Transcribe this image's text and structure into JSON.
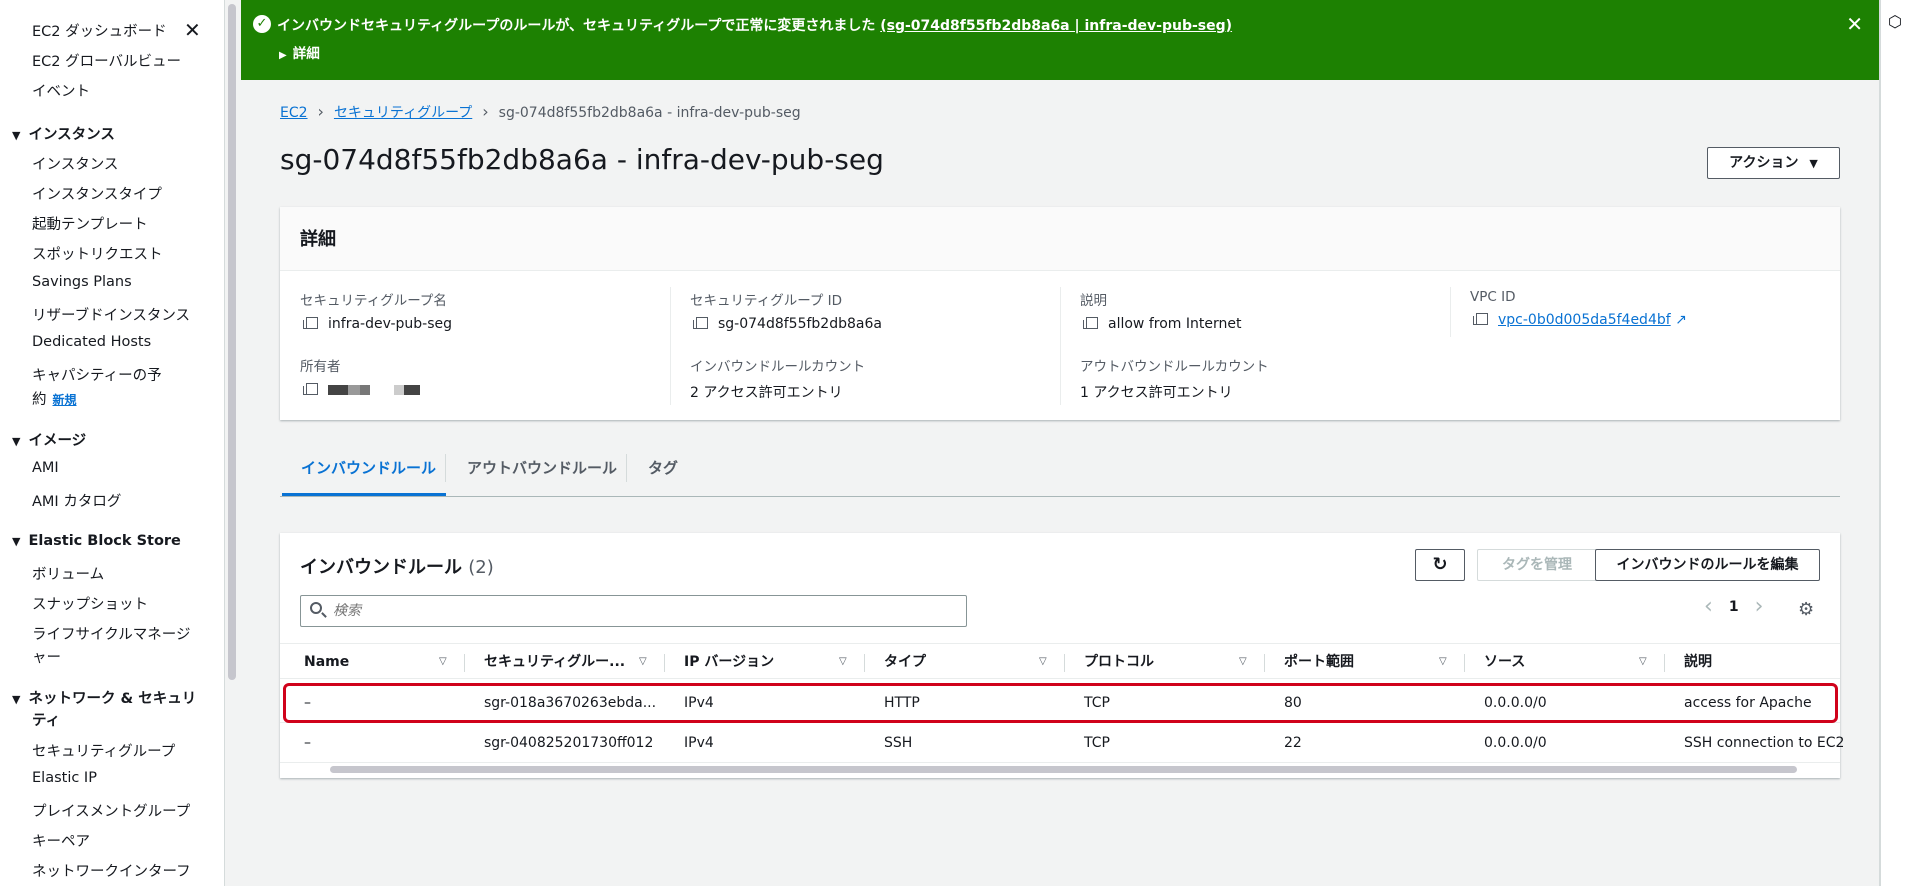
{
  "sidebar": {
    "top_items": [
      "EC2 ダッシュボード",
      "EC2 グローバルビュー",
      "イベント"
    ],
    "sections": [
      {
        "title": "インスタンス",
        "items": [
          "インスタンス",
          "インスタンスタイプ",
          "起動テンプレート",
          "スポットリクエスト",
          "Savings Plans",
          "リザーブドインスタンス",
          "Dedicated Hosts",
          "キャパシティーの予",
          "約"
        ]
      },
      {
        "title": "イメージ",
        "items": [
          "AMI",
          "AMI カタログ"
        ]
      },
      {
        "title": "Elastic Block Store",
        "items": [
          "ボリューム",
          "スナップショット",
          "ライフサイクルマネージ",
          "ャー"
        ]
      },
      {
        "title": "ネットワーク & セキュリ",
        "title2": "ティ",
        "items": [
          "セキュリティグループ",
          "Elastic IP",
          "プレイスメントグループ",
          "キーペア",
          "ネットワークインターフ"
        ]
      }
    ],
    "new_badge": "新規"
  },
  "flash": {
    "message": "インバウンドセキュリティグループのルールが、セキュリティグループで正常に変更されました",
    "link": "(sg-074d8f55fb2db8a6a | infra-dev-pub-seg)",
    "details": "詳細"
  },
  "breadcrumb": {
    "ec2": "EC2",
    "sg": "セキュリティグループ",
    "current": "sg-074d8f55fb2db8a6a - infra-dev-pub-seg"
  },
  "page_title": "sg-074d8f55fb2db8a6a - infra-dev-pub-seg",
  "action_label": "アクション",
  "details": {
    "heading": "詳細",
    "sg_name_label": "セキュリティグループ名",
    "sg_name": "infra-dev-pub-seg",
    "sg_id_label": "セキュリティグループ ID",
    "sg_id": "sg-074d8f55fb2db8a6a",
    "desc_label": "説明",
    "desc": "allow from Internet",
    "vpc_label": "VPC ID",
    "vpc": "vpc-0b0d005da5f4ed4bf",
    "owner_label": "所有者",
    "inbound_count_label": "インバウンドルールカウント",
    "inbound_count": "2 アクセス許可エントリ",
    "outbound_count_label": "アウトバウンドルールカウント",
    "outbound_count": "1 アクセス許可エントリ"
  },
  "tabs": [
    "インバウンドルール",
    "アウトバウンドルール",
    "タグ"
  ],
  "rules": {
    "title": "インバウンドルール",
    "count": "(2)",
    "manage_tags": "タグを管理",
    "edit_rules": "インバウンドのルールを編集",
    "search_placeholder": "検索",
    "page": "1",
    "columns": [
      "Name",
      "セキュリティグルー...",
      "IP バージョン",
      "タイプ",
      "プロトコル",
      "ポート範囲",
      "ソース",
      "説明"
    ],
    "rows": [
      [
        "–",
        "sgr-018a3670263ebda...",
        "IPv4",
        "HTTP",
        "TCP",
        "80",
        "0.0.0.0/0",
        "access for Apache"
      ],
      [
        "–",
        "sgr-040825201730ff012",
        "IPv4",
        "SSH",
        "TCP",
        "22",
        "0.0.0.0/0",
        "SSH connection to EC2"
      ]
    ]
  }
}
